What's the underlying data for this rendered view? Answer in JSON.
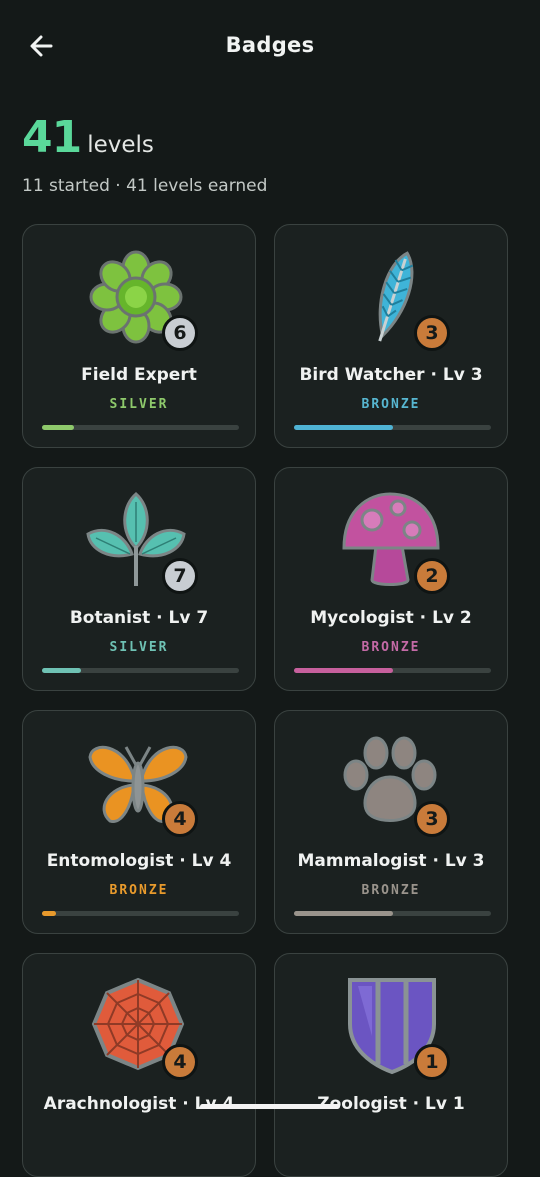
{
  "header": {
    "title": "Badges",
    "back_icon": "arrow-left-icon"
  },
  "summary": {
    "count": "41",
    "unit": "levels",
    "subtitle": "11 started · 41 levels earned"
  },
  "badges": [
    {
      "name": "Field Expert",
      "tier": "SILVER",
      "level": "6",
      "icon": "flower-icon",
      "tier_color": "#8ec96b",
      "num_color": "#c8cdd2",
      "progress": 0.16,
      "bar_color": "#8ec96b"
    },
    {
      "name": "Bird Watcher · Lv 3",
      "tier": "BRONZE",
      "level": "3",
      "icon": "feather-icon",
      "tier_color": "#57b6d0",
      "num_color": "#c97b3a",
      "progress": 0.5,
      "bar_color": "#4fb3d4"
    },
    {
      "name": "Botanist · Lv 7",
      "tier": "SILVER",
      "level": "7",
      "icon": "leaf-icon",
      "tier_color": "#6fc2b4",
      "num_color": "#c8cdd2",
      "progress": 0.2,
      "bar_color": "#6fc2b4"
    },
    {
      "name": "Mycologist · Lv 2",
      "tier": "BRONZE",
      "level": "2",
      "icon": "mushroom-icon",
      "tier_color": "#c46aa6",
      "num_color": "#c97b3a",
      "progress": 0.5,
      "bar_color": "#c7609d"
    },
    {
      "name": "Entomologist · Lv 4",
      "tier": "BRONZE",
      "level": "4",
      "icon": "butterfly-icon",
      "tier_color": "#e89a2c",
      "num_color": "#c97b3a",
      "progress": 0.07,
      "bar_color": "#e89a2c"
    },
    {
      "name": "Mammalogist · Lv 3",
      "tier": "BRONZE",
      "level": "3",
      "icon": "paw-icon",
      "tier_color": "#9a948c",
      "num_color": "#c97b3a",
      "progress": 0.5,
      "bar_color": "#9a948c"
    },
    {
      "name": "Arachnologist · Lv 4",
      "tier": "",
      "level": "4",
      "icon": "spiderweb-icon",
      "tier_color": "#e0603f",
      "num_color": "#c97b3a",
      "progress": 0,
      "bar_color": "#e0603f"
    },
    {
      "name": "Zoologist · Lv 1",
      "tier": "",
      "level": "1",
      "icon": "shield-icon",
      "tier_color": "#7a66d0",
      "num_color": "#c97b3a",
      "progress": 0,
      "bar_color": "#7a66d0"
    }
  ]
}
